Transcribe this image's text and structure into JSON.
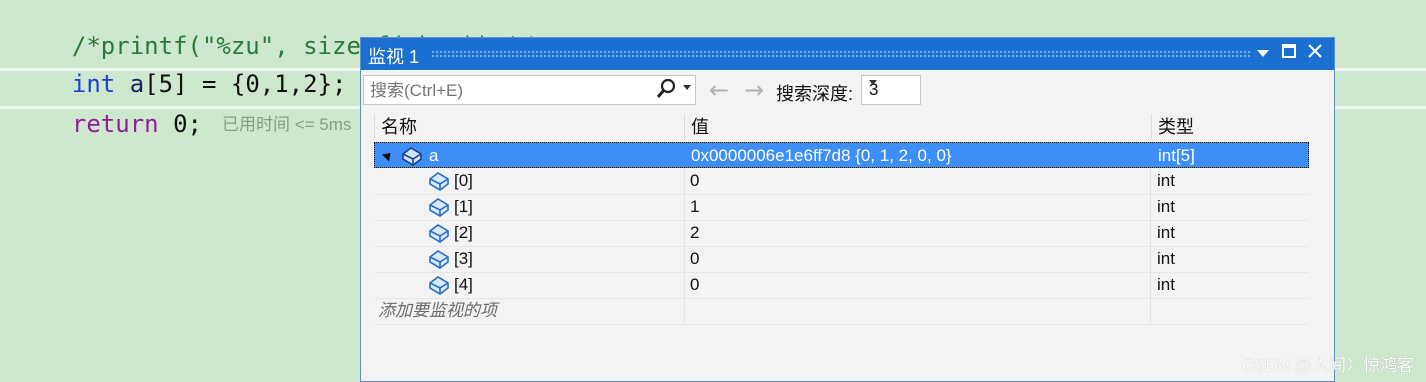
{
  "editor": {
    "line1": "/*printf(\"%zu\", sizeof(char));*/",
    "line2_keyword": "int",
    "line2_rest_ident": "a",
    "line2_rest": "[5] = {0,1,2};",
    "line3_keyword": "return",
    "line3_rest": "0;",
    "line3_hint": "已用时间 <= 5ms"
  },
  "watch": {
    "title": "监视 1",
    "search_placeholder": "搜索(Ctrl+E)",
    "depth_label": "搜索深度:",
    "depth_value": "3",
    "columns": {
      "name": "名称",
      "value": "值",
      "type": "类型"
    },
    "rows": [
      {
        "name": "a",
        "value": "0x0000006e1e6ff7d8 {0, 1, 2, 0, 0}",
        "type": "int[5]"
      },
      {
        "name": "[0]",
        "value": "0",
        "type": "int"
      },
      {
        "name": "[1]",
        "value": "1",
        "type": "int"
      },
      {
        "name": "[2]",
        "value": "2",
        "type": "int"
      },
      {
        "name": "[3]",
        "value": "0",
        "type": "int"
      },
      {
        "name": "[4]",
        "value": "0",
        "type": "int"
      }
    ],
    "add_item_placeholder": "添加要监视的项"
  },
  "watermark": "CSDN @人间冫惊鸿客",
  "icons": {
    "dropdown": "chevron-down-icon",
    "maximize": "maximize-icon",
    "close": "close-icon",
    "search": "search-icon",
    "back": "arrow-left-icon",
    "forward": "arrow-right-icon",
    "object": "variable-object-icon"
  },
  "colors": {
    "accent": "#1b6fd0",
    "selection": "#3d8ef7",
    "editor_bg": "#cde8cc"
  }
}
